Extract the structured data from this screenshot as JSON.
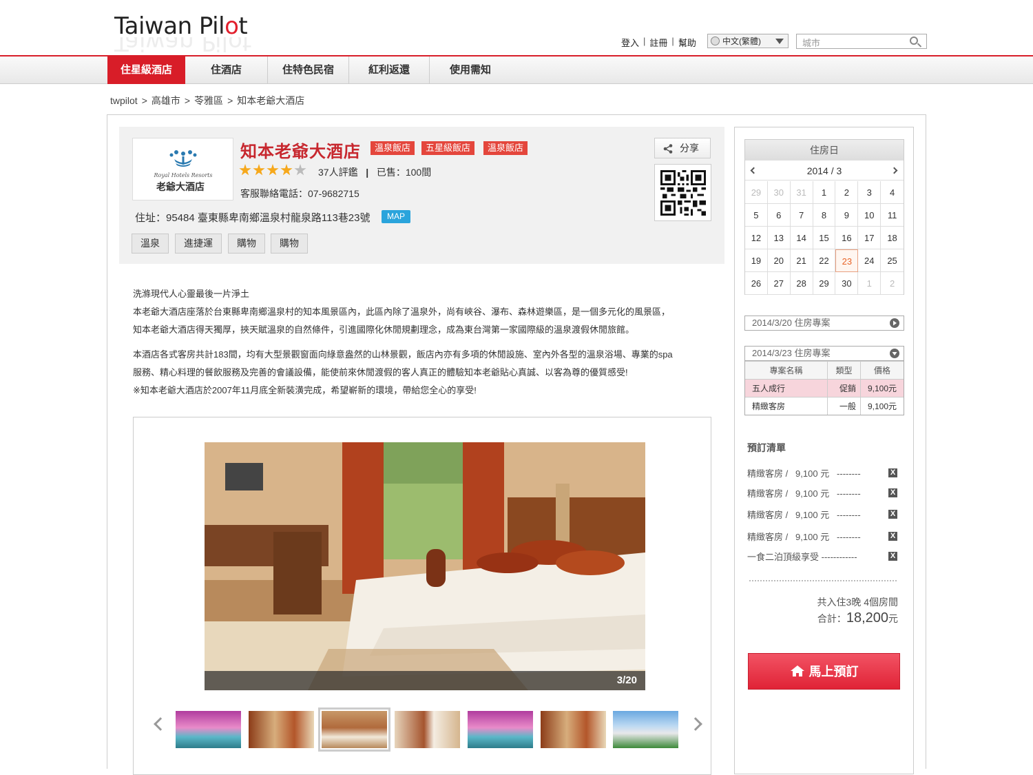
{
  "header": {
    "logo_main": "Taiwan Pil",
    "logo_o": "o",
    "logo_end": "t",
    "links": [
      "登入",
      "註冊",
      "幫助"
    ],
    "language": "中文(繁體)",
    "search_placeholder": "城市"
  },
  "nav": [
    "住星級酒店",
    "住酒店",
    "住特色民宿",
    "紅利返還",
    "使用需知"
  ],
  "breadcrumb": [
    "twpilot",
    ">",
    "高雄市",
    ">",
    "苓雅區",
    ">",
    "知本老爺大酒店"
  ],
  "hotel": {
    "name": "知本老爺大酒店",
    "tags": [
      "溫泉飯店",
      "五星級飯店",
      "溫泉飯店"
    ],
    "rating_stars": 4,
    "reviews": "37人評鑑",
    "sold": "已售：100間",
    "phone": "客服聯絡電話：07-9682715",
    "address": "住址：95484 臺東縣卑南鄉溫泉村龍泉路113巷23號",
    "map_label": "MAP",
    "chips": [
      "溫泉",
      "進捷運",
      "購物",
      "購物"
    ],
    "share_label": "分享",
    "logo_caption": "老爺大酒店"
  },
  "description": {
    "p1": [
      "洗滌現代人心靈最後一片淨土",
      "本老爺大酒店座落於台東縣卑南鄉溫泉村的知本風景區內，此區內除了溫泉外，尚有峽谷、瀑布、森林遊樂區，是一個多元化的風景區，",
      "知本老爺大酒店得天獨厚，挾天賦溫泉的自然條件，引進國際化休閒規劃理念，成為東台灣第一家國際級的溫泉渡假休閒旅館。"
    ],
    "p2": [
      "本酒店各式客房共計183間，均有大型景觀窗面向綠意盎然的山林景觀，飯店內亦有多項的休閒設施、室內外各型的溫泉浴場、專業的spa",
      "服務、精心料理的餐飲服務及完善的會議設備，能使前來休閒渡假的客人真正的體驗知本老爺貼心真誠、以客為尊的優質感受!",
      "※知本老爺大酒店於2007年11月底全新裝潢完成，希望嶄新的環境，帶給您全心的享受!"
    ]
  },
  "gallery": {
    "counter": "3/20",
    "current": 3,
    "total": 20,
    "selected_thumb": 3
  },
  "calendar": {
    "header": "住房日",
    "month": "2014 / 3",
    "days": [
      [
        "29",
        "30",
        "31",
        "1",
        "2",
        "3",
        "4"
      ],
      [
        "5",
        "6",
        "7",
        "8",
        "9",
        "10",
        "11"
      ],
      [
        "12",
        "13",
        "14",
        "15",
        "16",
        "17",
        "18"
      ],
      [
        "19",
        "20",
        "21",
        "22",
        "23",
        "24",
        "25"
      ],
      [
        "26",
        "27",
        "28",
        "29",
        "30",
        "1",
        "2"
      ]
    ],
    "today": "23"
  },
  "plans": {
    "plan1": "2014/3/20 住房專案",
    "plan2": "2014/3/23 住房專案",
    "table_headers": [
      "專案名稱",
      "類型",
      "價格"
    ],
    "rows": [
      {
        "name": "五人成行",
        "type": "促銷",
        "price": "9,100元"
      },
      {
        "name": "精緻客房",
        "type": "一般",
        "price": "9,100元"
      }
    ]
  },
  "booking": {
    "title": "預訂清單",
    "items": [
      "精緻客房 /   9,100 元   --------",
      "精緻客房 /   9,100 元   --------",
      "精緻客房 /   9,100 元   --------",
      "精緻客房 /   9,100 元   --------",
      "一食二泊頂級享受 ------------"
    ],
    "remove_label": "X",
    "summary": "共入住3晚 4個房間",
    "total_label": "合計：",
    "total_value": "18,200",
    "total_unit": "元",
    "book_button": "馬上預訂"
  },
  "colors": {
    "brand_red": "#d81d28",
    "tag_red": "#e4463c",
    "map_blue": "#2aa4dc",
    "star": "#f6a81b"
  }
}
